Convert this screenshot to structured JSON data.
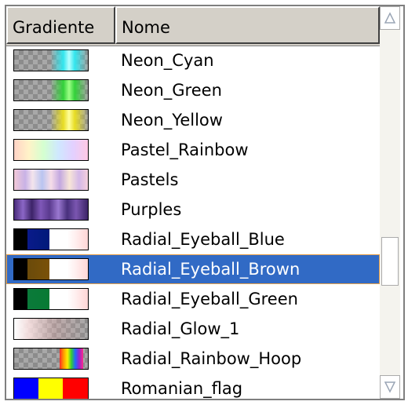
{
  "header": {
    "col1": "Gradiente",
    "col2": "Nome"
  },
  "selected_index": 7,
  "colors": {
    "selection": "#316ac5",
    "selection_outline": "#e6a04c"
  },
  "rows": [
    {
      "name": "Neon_Cyan",
      "icon": "neon-cyan-gradient-icon"
    },
    {
      "name": "Neon_Green",
      "icon": "neon-green-gradient-icon"
    },
    {
      "name": "Neon_Yellow",
      "icon": "neon-yellow-gradient-icon"
    },
    {
      "name": "Pastel_Rainbow",
      "icon": "pastel-rainbow-gradient-icon"
    },
    {
      "name": "Pastels",
      "icon": "pastels-gradient-icon"
    },
    {
      "name": "Purples",
      "icon": "purples-gradient-icon"
    },
    {
      "name": "Radial_Eyeball_Blue",
      "icon": "radial-eyeball-blue-gradient-icon"
    },
    {
      "name": "Radial_Eyeball_Brown",
      "icon": "radial-eyeball-brown-gradient-icon"
    },
    {
      "name": "Radial_Eyeball_Green",
      "icon": "radial-eyeball-green-gradient-icon"
    },
    {
      "name": "Radial_Glow_1",
      "icon": "radial-glow-gradient-icon"
    },
    {
      "name": "Radial_Rainbow_Hoop",
      "icon": "radial-rainbow-hoop-gradient-icon"
    },
    {
      "name": "Romanian_flag",
      "icon": "romanian-flag-gradient-icon"
    }
  ]
}
